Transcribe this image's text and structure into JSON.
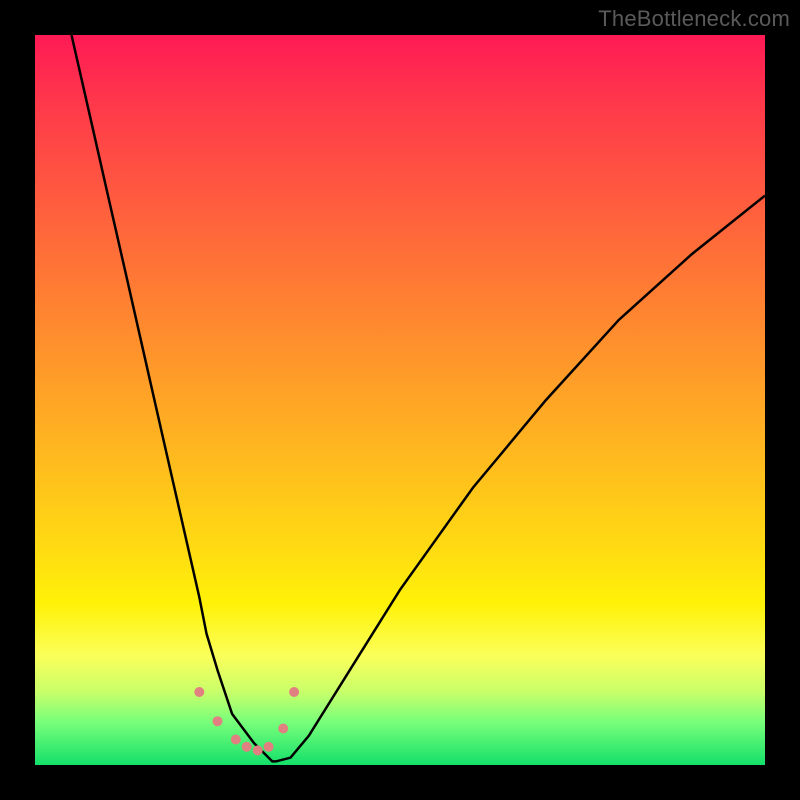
{
  "watermark": "TheBottleneck.com",
  "chart_data": {
    "type": "line",
    "title": "",
    "xlabel": "",
    "ylabel": "",
    "xlim": [
      0,
      100
    ],
    "ylim": [
      0,
      100
    ],
    "grid": false,
    "legend": false,
    "series": [
      {
        "name": "curve",
        "x": [
          5,
          7.5,
          10,
          12.5,
          15,
          17.5,
          20,
          22.5,
          23.5,
          25,
          27,
          30,
          32.5,
          33,
          35,
          37.5,
          40,
          45,
          50,
          55,
          60,
          70,
          80,
          90,
          100
        ],
        "y": [
          100,
          89,
          78,
          67,
          56,
          45,
          34,
          23,
          18,
          13,
          7,
          3,
          0.5,
          0.5,
          1,
          4,
          8,
          16,
          24,
          31,
          38,
          50,
          61,
          70,
          78
        ]
      }
    ],
    "markers": {
      "name": "bottom-cluster",
      "x": [
        22.5,
        25,
        27.5,
        29,
        30.5,
        32,
        34,
        35.5
      ],
      "y": [
        10,
        6,
        3.5,
        2.5,
        2,
        2.5,
        5,
        10
      ],
      "color": "#e08080",
      "size": 10
    },
    "gradient_stops": [
      {
        "pos": 0,
        "color": "#ff1a55"
      },
      {
        "pos": 78,
        "color": "#fff208"
      },
      {
        "pos": 100,
        "color": "#14e06a"
      }
    ]
  }
}
